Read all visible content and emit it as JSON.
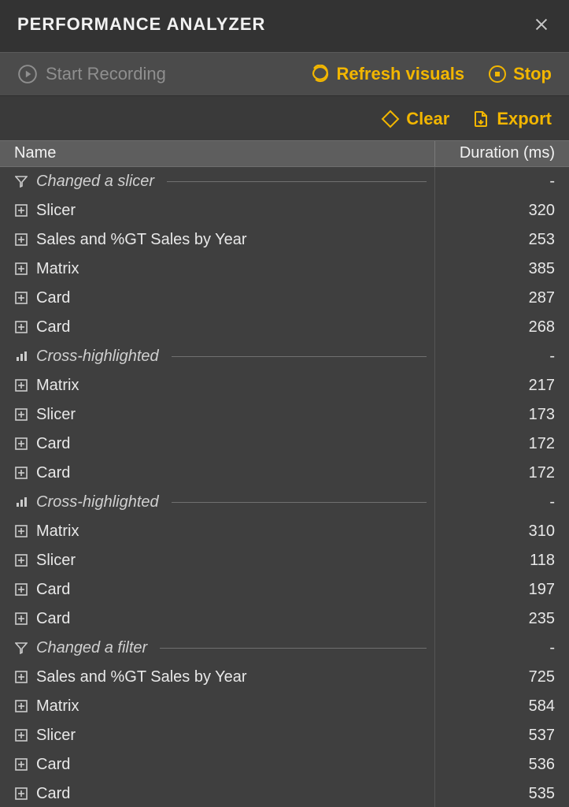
{
  "title": "PERFORMANCE ANALYZER",
  "toolbar": {
    "start_label": "Start Recording",
    "refresh_label": "Refresh visuals",
    "stop_label": "Stop",
    "clear_label": "Clear",
    "export_label": "Export"
  },
  "columns": {
    "name": "Name",
    "duration": "Duration (ms)"
  },
  "rows": [
    {
      "type": "group",
      "icon": "funnel",
      "label": "Changed a slicer",
      "duration": "-"
    },
    {
      "type": "item",
      "icon": "plus",
      "label": "Slicer",
      "duration": "320"
    },
    {
      "type": "item",
      "icon": "plus",
      "label": "Sales and %GT Sales by Year",
      "duration": "253"
    },
    {
      "type": "item",
      "icon": "plus",
      "label": "Matrix",
      "duration": "385"
    },
    {
      "type": "item",
      "icon": "plus",
      "label": "Card",
      "duration": "287"
    },
    {
      "type": "item",
      "icon": "plus",
      "label": "Card",
      "duration": "268"
    },
    {
      "type": "group",
      "icon": "bars",
      "label": "Cross-highlighted",
      "duration": "-"
    },
    {
      "type": "item",
      "icon": "plus",
      "label": "Matrix",
      "duration": "217"
    },
    {
      "type": "item",
      "icon": "plus",
      "label": "Slicer",
      "duration": "173"
    },
    {
      "type": "item",
      "icon": "plus",
      "label": "Card",
      "duration": "172"
    },
    {
      "type": "item",
      "icon": "plus",
      "label": "Card",
      "duration": "172"
    },
    {
      "type": "group",
      "icon": "bars",
      "label": "Cross-highlighted",
      "duration": "-"
    },
    {
      "type": "item",
      "icon": "plus",
      "label": "Matrix",
      "duration": "310"
    },
    {
      "type": "item",
      "icon": "plus",
      "label": "Slicer",
      "duration": "118"
    },
    {
      "type": "item",
      "icon": "plus",
      "label": "Card",
      "duration": "197"
    },
    {
      "type": "item",
      "icon": "plus",
      "label": "Card",
      "duration": "235"
    },
    {
      "type": "group",
      "icon": "funnel",
      "label": "Changed a filter",
      "duration": "-"
    },
    {
      "type": "item",
      "icon": "plus",
      "label": "Sales and %GT Sales by Year",
      "duration": "725"
    },
    {
      "type": "item",
      "icon": "plus",
      "label": "Matrix",
      "duration": "584"
    },
    {
      "type": "item",
      "icon": "plus",
      "label": "Slicer",
      "duration": "537"
    },
    {
      "type": "item",
      "icon": "plus",
      "label": "Card",
      "duration": "536"
    },
    {
      "type": "item",
      "icon": "plus",
      "label": "Card",
      "duration": "535"
    }
  ]
}
